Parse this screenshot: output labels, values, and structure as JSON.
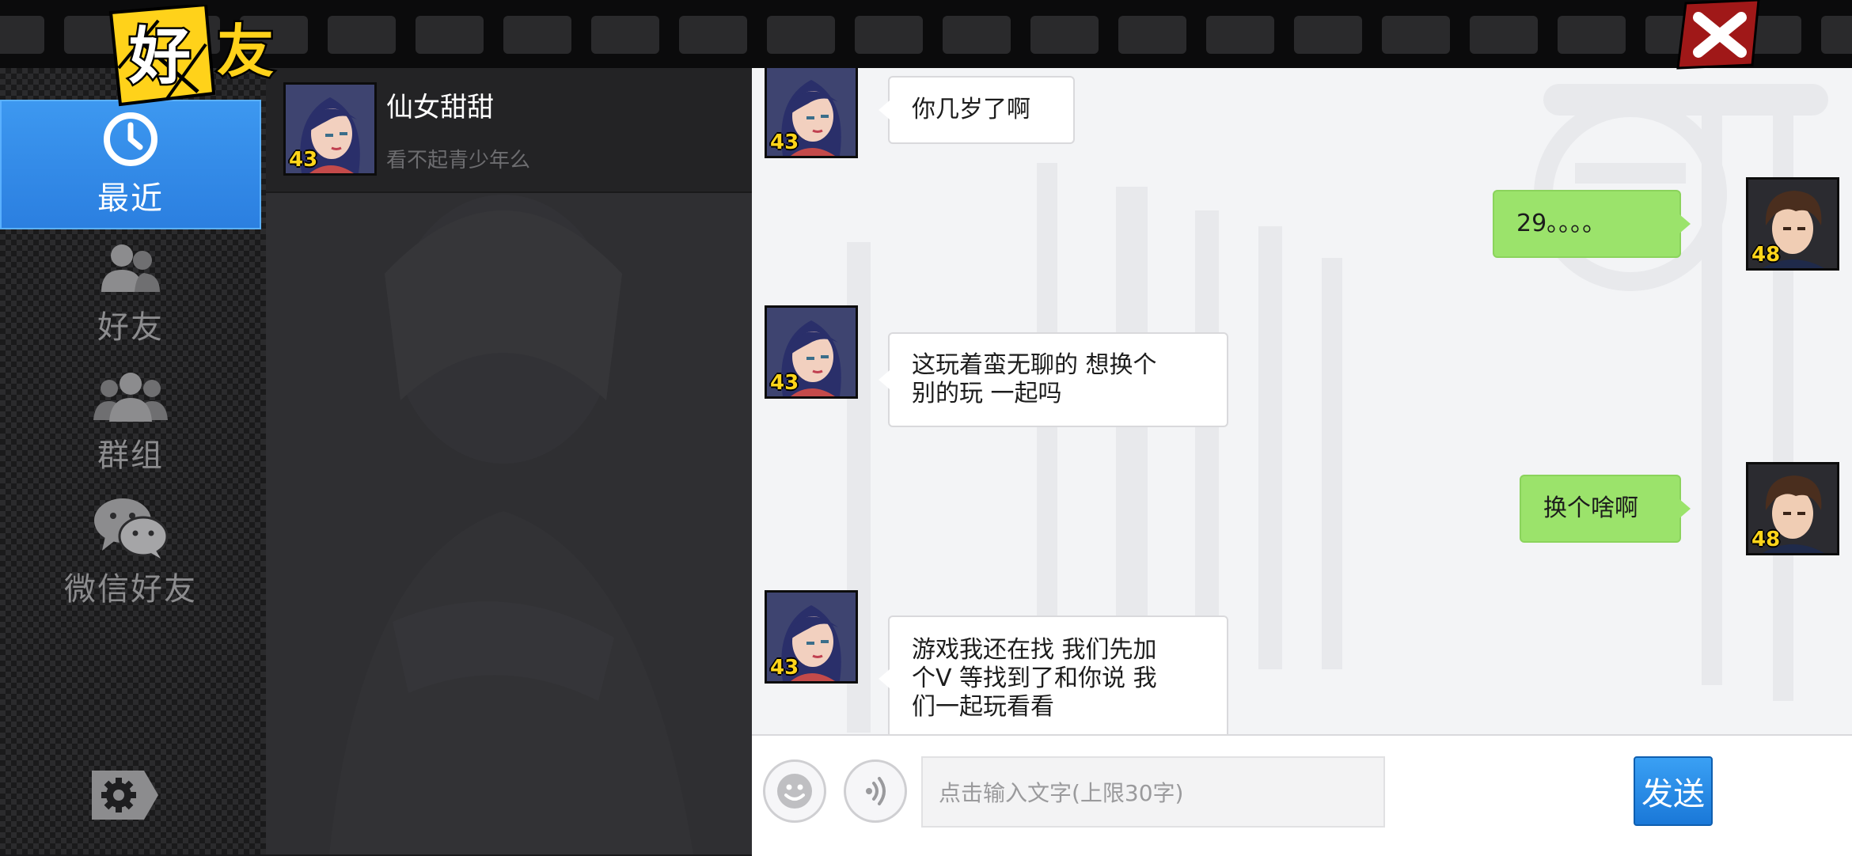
{
  "header": {
    "title_char_1": "好",
    "title_char_2": "友",
    "close_icon": "close-x-icon"
  },
  "sidebar": {
    "items": [
      {
        "label": "最近",
        "icon": "clock-icon",
        "active": true
      },
      {
        "label": "好友",
        "icon": "friends-icon",
        "active": false
      },
      {
        "label": "群组",
        "icon": "group-icon",
        "active": false
      },
      {
        "label": "微信好友",
        "icon": "wechat-icon",
        "active": false
      }
    ],
    "settings_icon": "gear-icon"
  },
  "contacts": [
    {
      "name": "仙女甜甜",
      "status": "看不起青少年么",
      "level": "43"
    }
  ],
  "chat": {
    "messages": [
      {
        "side": "left",
        "text": "你几岁了啊",
        "level": "43"
      },
      {
        "side": "right",
        "text": "29。。。。",
        "level": "48"
      },
      {
        "side": "left",
        "text": "这玩着蛮无聊的 想换个\n别的玩 一起吗",
        "level": "43"
      },
      {
        "side": "right",
        "text": "换个啥啊",
        "level": "48"
      },
      {
        "side": "left",
        "text": "游戏我还在找 我们先加\n个V 等找到了和你说 我\n们一起玩看看",
        "level": "43"
      }
    ]
  },
  "input": {
    "placeholder": "点击输入文字(上限30字)",
    "send_label": "发送",
    "emoji_icon": "smiley-icon",
    "voice_icon": "voice-icon"
  },
  "colors": {
    "accent_blue": "#2b7fe0",
    "bubble_green": "#9be36b",
    "level_yellow": "#ffd51a",
    "close_red": "#a01818"
  }
}
